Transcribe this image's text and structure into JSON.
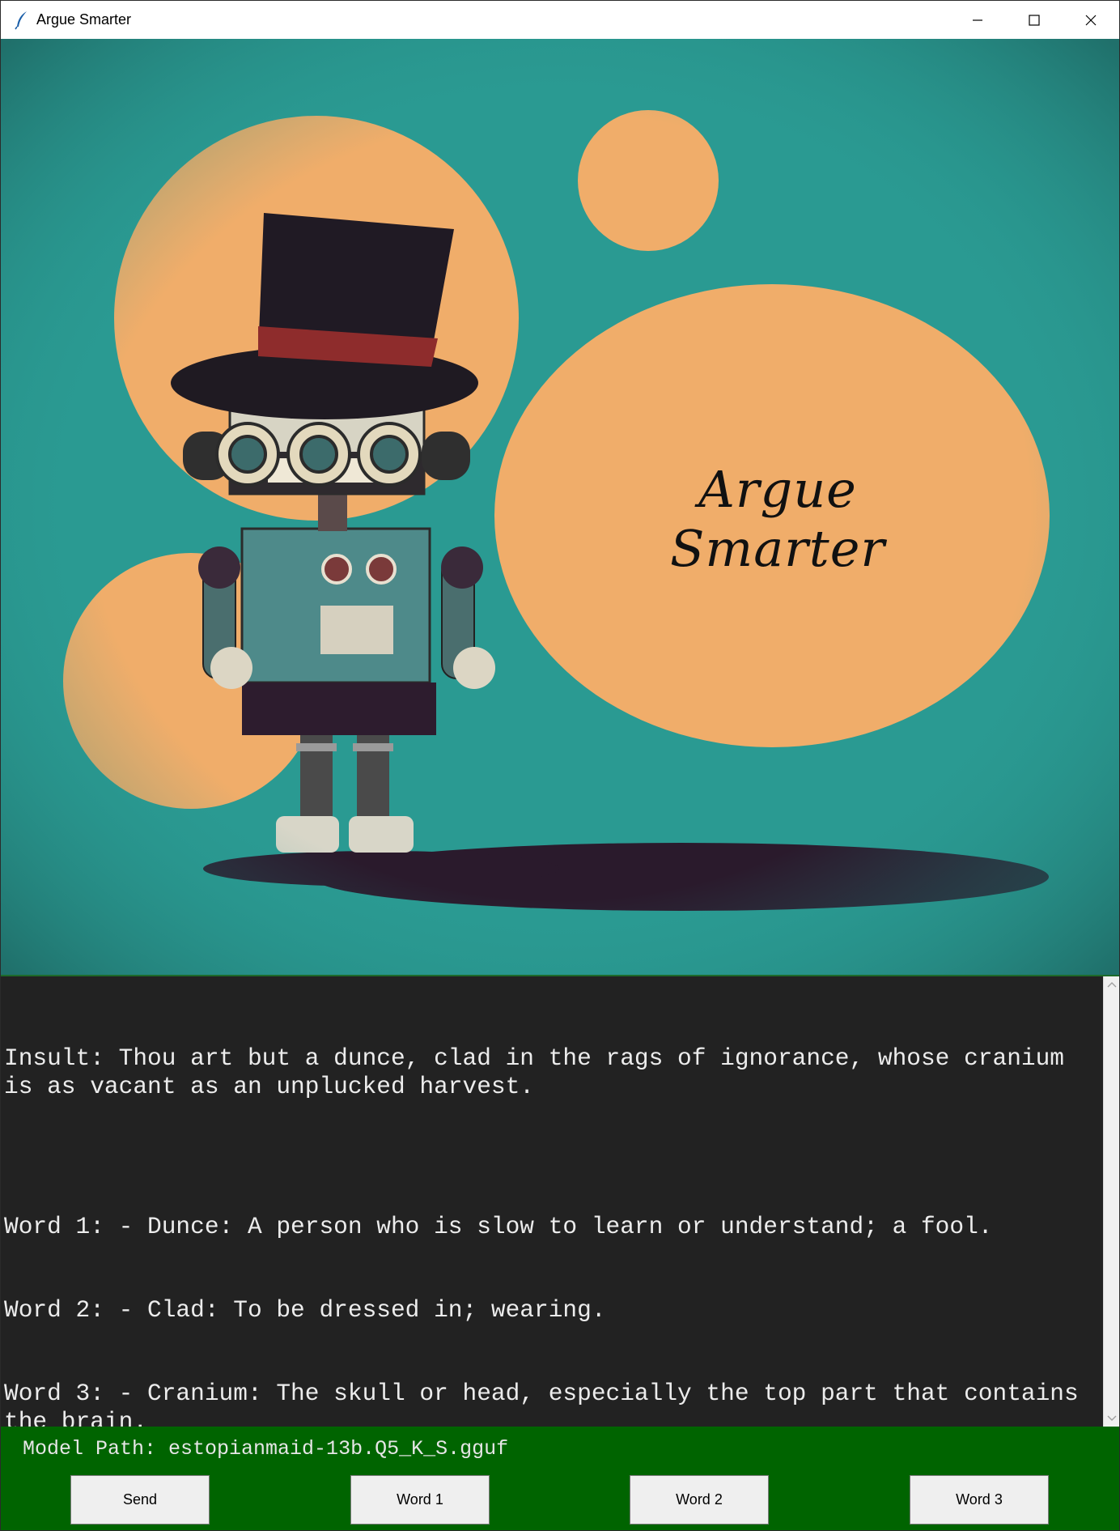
{
  "window": {
    "title": "Argue Smarter",
    "controls": [
      "minimize-icon",
      "maximize-icon",
      "close-icon"
    ]
  },
  "banner": {
    "title": "Argue Smarter",
    "colors": {
      "background": "#2a9a92",
      "circles": "#f0ad6a",
      "shadow": "#2a1a2c"
    }
  },
  "output": {
    "insult": "Insult: Thou art but a dunce, clad in the rags of ignorance, whose cranium is as vacant as an unplucked harvest.",
    "word1": "Word 1: - Dunce: A person who is slow to learn or understand; a fool.",
    "word2": "Word 2: - Clad: To be dressed in; wearing.",
    "word3": "Word 3: - Cranium: The skull or head, especially the top part that contains the brain."
  },
  "footer": {
    "model_path": "Model Path: estopianmaid-13b.Q5_K_S.gguf",
    "buttons": {
      "send": "Send",
      "word1": "Word 1",
      "word2": "Word 2",
      "word3": "Word 3"
    },
    "background": "#006400"
  }
}
